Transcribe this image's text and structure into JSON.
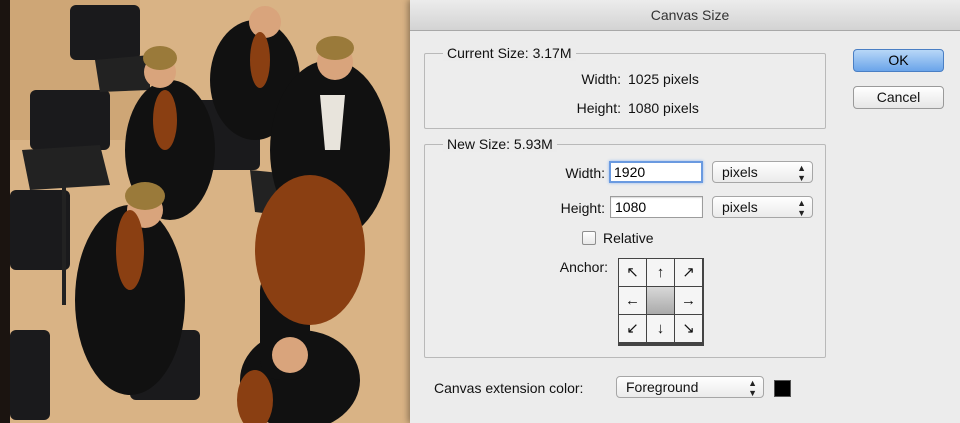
{
  "dialog": {
    "title": "Canvas Size",
    "current": {
      "title": "Current Size: 3.17M",
      "width_label": "Width:",
      "width_value": "1025 pixels",
      "height_label": "Height:",
      "height_value": "1080 pixels"
    },
    "new": {
      "title": "New Size: 5.93M",
      "width_label": "Width:",
      "width_value": "1920",
      "width_unit": "pixels",
      "height_label": "Height:",
      "height_value": "1080",
      "height_unit": "pixels",
      "relative_label": "Relative",
      "relative_checked": false,
      "anchor_label": "Anchor:",
      "anchor_arrows": [
        "↖",
        "↑",
        "↗",
        "←",
        "",
        "→",
        "↙",
        "↓",
        "↘"
      ]
    },
    "extension": {
      "label": "Canvas extension color:",
      "value": "Foreground",
      "swatch_color": "#000000"
    },
    "buttons": {
      "ok": "OK",
      "cancel": "Cancel"
    }
  }
}
